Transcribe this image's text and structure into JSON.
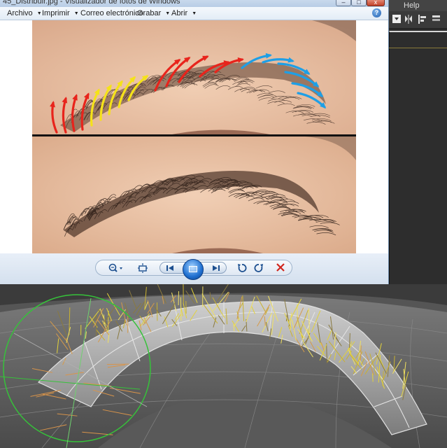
{
  "max": {
    "menubar": {
      "help_label": "Help"
    }
  },
  "viewer": {
    "title": "45_Distribuir.jpg - Visualizador de fotos de Windows",
    "window_buttons": {
      "minimize": "–",
      "maximize": "□",
      "close": "x"
    },
    "menu": [
      {
        "label": "Archivo"
      },
      {
        "label": "Imprimir"
      },
      {
        "label": "Correo electrónico"
      },
      {
        "label": "Grabar"
      },
      {
        "label": "Abrir"
      }
    ],
    "help_label": "?",
    "controls": {
      "zoom": "zoom-icon",
      "fit": "actual-size-icon",
      "previous": "previous-icon",
      "slideshow": "slideshow-icon",
      "next": "next-icon",
      "rotate_ccw": "rotate-ccw-icon",
      "rotate_cw": "rotate-cw-icon",
      "delete": "delete-icon"
    }
  },
  "colors": {
    "arrow_red": "#e8241c",
    "arrow_yellow": "#f5e21a",
    "arrow_blue": "#1e9fe6",
    "skin": "#e9c3a6"
  }
}
